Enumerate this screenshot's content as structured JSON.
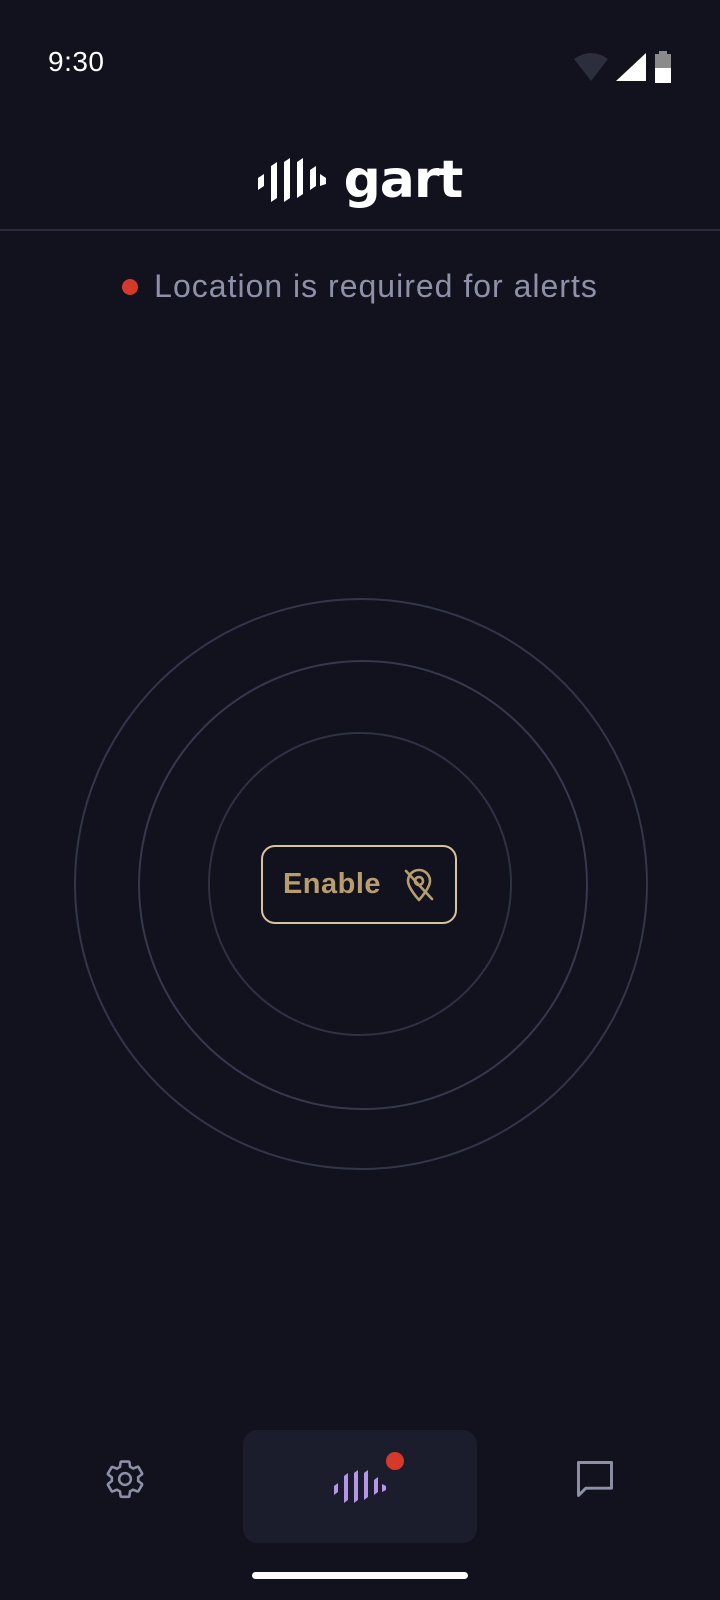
{
  "status_bar": {
    "time": "9:30",
    "icons": [
      "wifi-icon",
      "cellular-signal-icon",
      "battery-icon"
    ]
  },
  "header": {
    "logo_text": "gart"
  },
  "alert": {
    "text": "Location is required for alerts",
    "dot_color": "#d5392a"
  },
  "main": {
    "enable_button_label": "Enable",
    "enable_button_icon": "location-off-icon"
  },
  "bottom_nav": {
    "items": [
      {
        "icon": "gear-icon",
        "active": false
      },
      {
        "icon": "waveform-icon",
        "active": true,
        "badge": true
      },
      {
        "icon": "chat-bubble-icon",
        "active": false
      }
    ]
  },
  "colors": {
    "background": "#11121e",
    "accent_gold": "#d9c49a",
    "accent_purple": "#b596e8",
    "alert_red": "#d5392a",
    "muted_text": "#8e90a8"
  }
}
